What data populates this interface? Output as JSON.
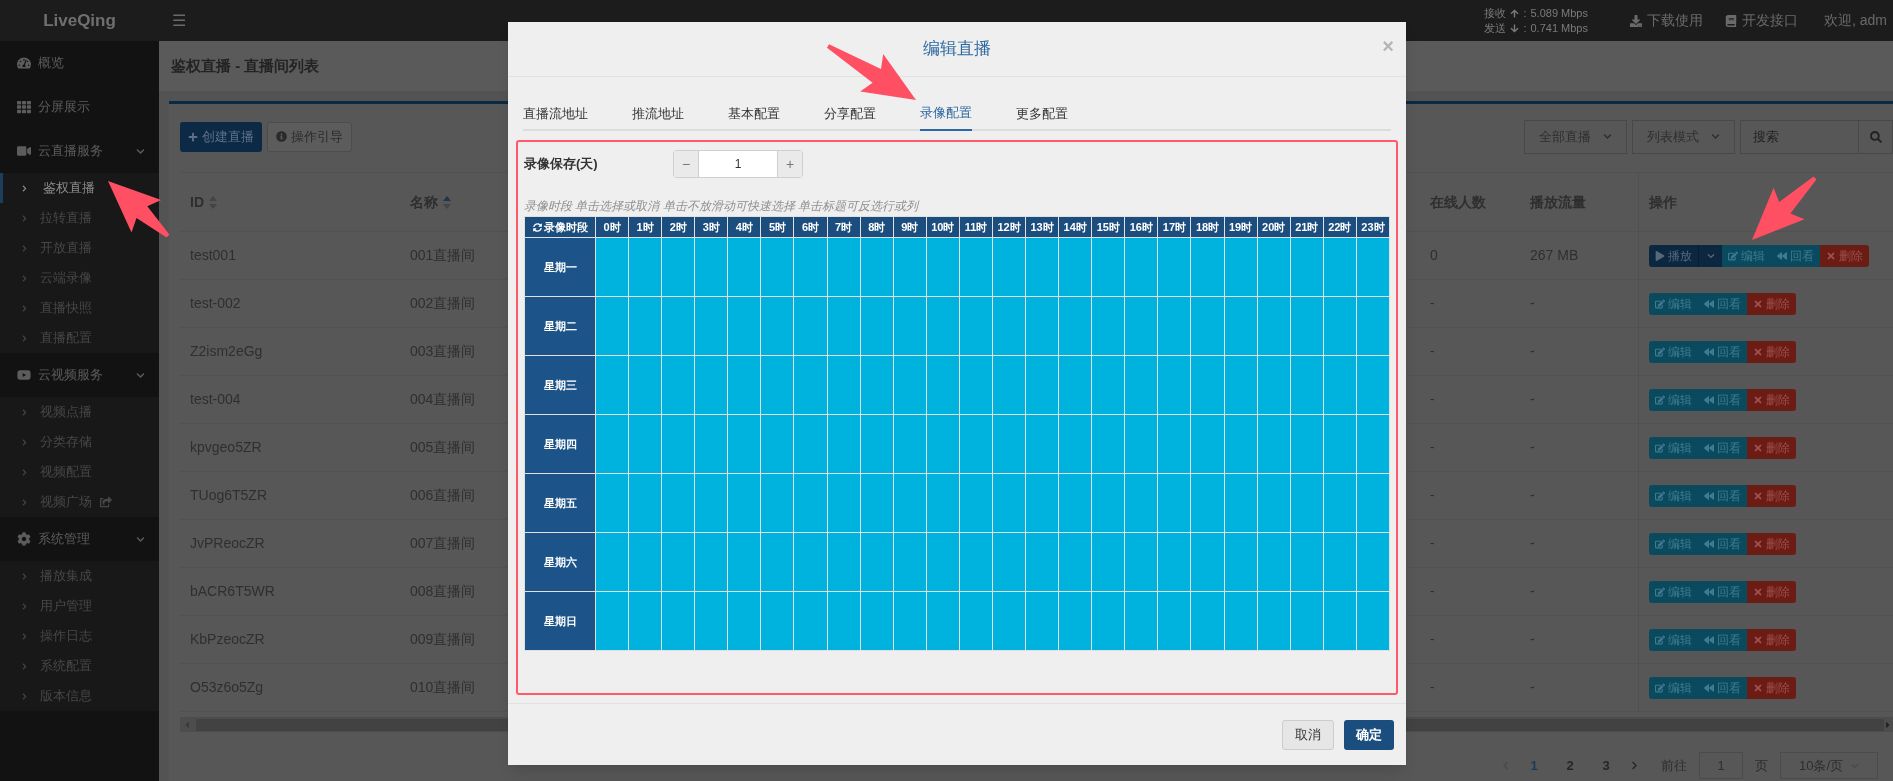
{
  "topbar": {
    "logo": "LiveQing",
    "menu": "☰",
    "stats": [
      {
        "label": "接收",
        "sep": ":",
        "value": "5.089 Mbps"
      },
      {
        "label": "发送",
        "sep": ":",
        "value": "0.741 Mbps"
      }
    ],
    "links": [
      {
        "label": "下载使用"
      },
      {
        "label": "开发接口"
      },
      {
        "label": "欢迎, adm"
      }
    ]
  },
  "sidebar": {
    "items": [
      {
        "label": "概览",
        "selected": false
      },
      {
        "label": "分屏展示",
        "selected": false
      },
      {
        "label": "云直播服务",
        "selected": false,
        "expanded": true,
        "children": [
          {
            "label": "鉴权直播",
            "kind": "link",
            "selected": true
          },
          {
            "label": "拉转直播",
            "kind": "link",
            "selected": false
          },
          {
            "label": "开放直播",
            "kind": "link",
            "selected": false
          },
          {
            "label": "云端录像",
            "kind": "link",
            "selected": false
          },
          {
            "label": "直播快照",
            "kind": "link",
            "selected": false
          },
          {
            "label": "直播配置",
            "kind": "link",
            "selected": false
          }
        ]
      },
      {
        "label": "云视频服务",
        "selected": false,
        "expanded": true,
        "children": [
          {
            "label": "视频点播",
            "kind": "link",
            "selected": false
          },
          {
            "label": "分类存储",
            "kind": "link",
            "selected": false
          },
          {
            "label": "视频配置",
            "kind": "link",
            "selected": false
          },
          {
            "label": "视频广场",
            "kind": "external",
            "selected": false
          }
        ]
      },
      {
        "label": "系统管理",
        "selected": false,
        "expanded": true,
        "children": [
          {
            "label": "播放集成",
            "kind": "link",
            "selected": false
          },
          {
            "label": "用户管理",
            "kind": "link",
            "selected": false
          },
          {
            "label": "操作日志",
            "kind": "link",
            "selected": false
          },
          {
            "label": "系统配置",
            "kind": "link",
            "selected": false
          },
          {
            "label": "版本信息",
            "kind": "link",
            "selected": false
          }
        ]
      }
    ]
  },
  "page": {
    "title": "鉴权直播 - 直播间列表",
    "actions": [
      {
        "label": "创建直播",
        "kind": "primary"
      },
      {
        "label": "操作引导",
        "kind": "default"
      }
    ],
    "filters": [
      "全部直播",
      "列表模式"
    ],
    "search": {
      "placeholder": "搜索"
    }
  },
  "table": {
    "columns": [
      {
        "label": "ID",
        "sortable": true,
        "sorted_ascending": false
      },
      {
        "label": "名称",
        "sortable": true,
        "sorted_ascending": true
      },
      {
        "label": "在线人数"
      },
      {
        "label": "播放流量"
      },
      {
        "label": "操作"
      }
    ],
    "rows": [
      {
        "id": "test001",
        "name": "001直播间",
        "online": "0",
        "traffic": "267 MB",
        "actions": [
          {
            "label": "播放",
            "kind": "play"
          },
          {
            "label": "编辑",
            "kind": "edit"
          },
          {
            "label": "回看",
            "kind": "replay"
          },
          {
            "label": "删除",
            "kind": "delete"
          }
        ]
      },
      {
        "id": "test-002",
        "name": "002直播间",
        "online": "-",
        "traffic": "-",
        "actions": [
          {
            "label": "编辑",
            "kind": "edit"
          },
          {
            "label": "回看",
            "kind": "replay"
          },
          {
            "label": "删除",
            "kind": "delete"
          }
        ]
      },
      {
        "id": "Z2ism2eGg",
        "name": "003直播间",
        "online": "-",
        "traffic": "-",
        "actions": [
          {
            "label": "编辑",
            "kind": "edit"
          },
          {
            "label": "回看",
            "kind": "replay"
          },
          {
            "label": "删除",
            "kind": "delete"
          }
        ]
      },
      {
        "id": "test-004",
        "name": "004直播间",
        "online": "-",
        "traffic": "-",
        "actions": [
          {
            "label": "编辑",
            "kind": "edit"
          },
          {
            "label": "回看",
            "kind": "replay"
          },
          {
            "label": "删除",
            "kind": "delete"
          }
        ]
      },
      {
        "id": "kpvgeo5ZR",
        "name": "005直播间",
        "online": "-",
        "traffic": "-",
        "actions": [
          {
            "label": "编辑",
            "kind": "edit"
          },
          {
            "label": "回看",
            "kind": "replay"
          },
          {
            "label": "删除",
            "kind": "delete"
          }
        ]
      },
      {
        "id": "TUog6T5ZR",
        "name": "006直播间",
        "online": "-",
        "traffic": "-",
        "actions": [
          {
            "label": "编辑",
            "kind": "edit"
          },
          {
            "label": "回看",
            "kind": "replay"
          },
          {
            "label": "删除",
            "kind": "delete"
          }
        ]
      },
      {
        "id": "JvPReocZR",
        "name": "007直播间",
        "online": "-",
        "traffic": "-",
        "actions": [
          {
            "label": "编辑",
            "kind": "edit"
          },
          {
            "label": "回看",
            "kind": "replay"
          },
          {
            "label": "删除",
            "kind": "delete"
          }
        ]
      },
      {
        "id": "bACR6T5WR",
        "name": "008直播间",
        "online": "-",
        "traffic": "-",
        "actions": [
          {
            "label": "编辑",
            "kind": "edit"
          },
          {
            "label": "回看",
            "kind": "replay"
          },
          {
            "label": "删除",
            "kind": "delete"
          }
        ]
      },
      {
        "id": "KbPzeocZR",
        "name": "009直播间",
        "online": "-",
        "traffic": "-",
        "actions": [
          {
            "label": "编辑",
            "kind": "edit"
          },
          {
            "label": "回看",
            "kind": "replay"
          },
          {
            "label": "删除",
            "kind": "delete"
          }
        ]
      },
      {
        "id": "O53z6o5Zg",
        "name": "010直播间",
        "online": "-",
        "traffic": "-",
        "actions": [
          {
            "label": "编辑",
            "kind": "edit"
          },
          {
            "label": "回看",
            "kind": "replay"
          },
          {
            "label": "删除",
            "kind": "delete"
          }
        ]
      }
    ]
  },
  "pagination": {
    "pages": [
      {
        "label": "1",
        "selected": true
      },
      {
        "label": "2",
        "selected": false
      },
      {
        "label": "3",
        "selected": false
      }
    ],
    "goto_label": "前往",
    "goto_value": "1",
    "page_suffix": "页",
    "page_size": "10条/页"
  },
  "modal": {
    "title": "编辑直播",
    "close": "×",
    "tabs": [
      {
        "label": "直播流地址",
        "selected": false
      },
      {
        "label": "推流地址",
        "selected": false
      },
      {
        "label": "基本配置",
        "selected": false
      },
      {
        "label": "分享配置",
        "selected": false
      },
      {
        "label": "录像配置",
        "selected": true
      },
      {
        "label": "更多配置",
        "selected": false
      }
    ],
    "retention": {
      "label": "录像保存(天)",
      "decrement": "−",
      "value": "1",
      "increment": "+"
    },
    "hint": "录像时段 单击选择或取消 单击不放滑动可快速选择 单击标题可反选行或列",
    "schedule": {
      "corner": "录像时段",
      "hours": [
        "0时",
        "1时",
        "2时",
        "3时",
        "4时",
        "5时",
        "6时",
        "7时",
        "8时",
        "9时",
        "10时",
        "11时",
        "12时",
        "13时",
        "14时",
        "15时",
        "16时",
        "17时",
        "18时",
        "19时",
        "20时",
        "21时",
        "22时",
        "23时"
      ],
      "rows": [
        {
          "day": "星期一",
          "slots": [
            true,
            true,
            true,
            true,
            true,
            true,
            true,
            true,
            true,
            true,
            true,
            true,
            true,
            true,
            true,
            true,
            true,
            true,
            true,
            true,
            true,
            true,
            true,
            true
          ]
        },
        {
          "day": "星期二",
          "slots": [
            true,
            true,
            true,
            true,
            true,
            true,
            true,
            true,
            true,
            true,
            true,
            true,
            true,
            true,
            true,
            true,
            true,
            true,
            true,
            true,
            true,
            true,
            true,
            true
          ]
        },
        {
          "day": "星期三",
          "slots": [
            true,
            true,
            true,
            true,
            true,
            true,
            true,
            true,
            true,
            true,
            true,
            true,
            true,
            true,
            true,
            true,
            true,
            true,
            true,
            true,
            true,
            true,
            true,
            true
          ]
        },
        {
          "day": "星期四",
          "slots": [
            true,
            true,
            true,
            true,
            true,
            true,
            true,
            true,
            true,
            true,
            true,
            true,
            true,
            true,
            true,
            true,
            true,
            true,
            true,
            true,
            true,
            true,
            true,
            true
          ]
        },
        {
          "day": "星期五",
          "slots": [
            true,
            true,
            true,
            true,
            true,
            true,
            true,
            true,
            true,
            true,
            true,
            true,
            true,
            true,
            true,
            true,
            true,
            true,
            true,
            true,
            true,
            true,
            true,
            true
          ]
        },
        {
          "day": "星期六",
          "slots": [
            true,
            true,
            true,
            true,
            true,
            true,
            true,
            true,
            true,
            true,
            true,
            true,
            true,
            true,
            true,
            true,
            true,
            true,
            true,
            true,
            true,
            true,
            true,
            true
          ]
        },
        {
          "day": "星期日",
          "slots": [
            true,
            true,
            true,
            true,
            true,
            true,
            true,
            true,
            true,
            true,
            true,
            true,
            true,
            true,
            true,
            true,
            true,
            true,
            true,
            true,
            true,
            true,
            true,
            true
          ]
        }
      ]
    },
    "buttons": [
      {
        "label": "取消",
        "kind": "default"
      },
      {
        "label": "确定",
        "kind": "primary"
      }
    ]
  }
}
